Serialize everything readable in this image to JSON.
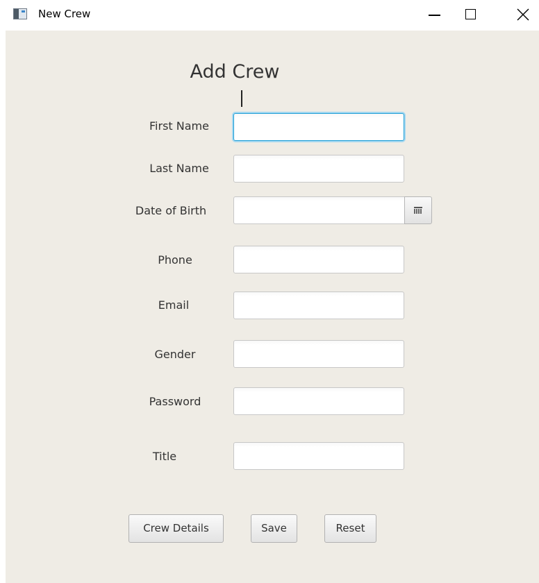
{
  "window": {
    "title": "New Crew"
  },
  "form": {
    "heading": "Add Crew",
    "fields": [
      {
        "label": "First Name",
        "value": ""
      },
      {
        "label": "Last Name",
        "value": ""
      },
      {
        "label": "Date of Birth",
        "value": ""
      },
      {
        "label": "Phone",
        "value": ""
      },
      {
        "label": "Email",
        "value": ""
      },
      {
        "label": "Gender",
        "value": ""
      },
      {
        "label": "Password",
        "value": ""
      },
      {
        "label": "Title",
        "value": ""
      }
    ],
    "buttons": {
      "crew_details": "Crew Details",
      "save": "Save",
      "reset": "Reset"
    }
  },
  "icons": {
    "app": "app-window-icon",
    "minimize": "minimize-icon",
    "maximize": "maximize-icon",
    "close": "close-icon",
    "calendar": "calendar-icon"
  },
  "colors": {
    "content_background": "#efece5",
    "focus_accent": "#1f9fd6"
  }
}
